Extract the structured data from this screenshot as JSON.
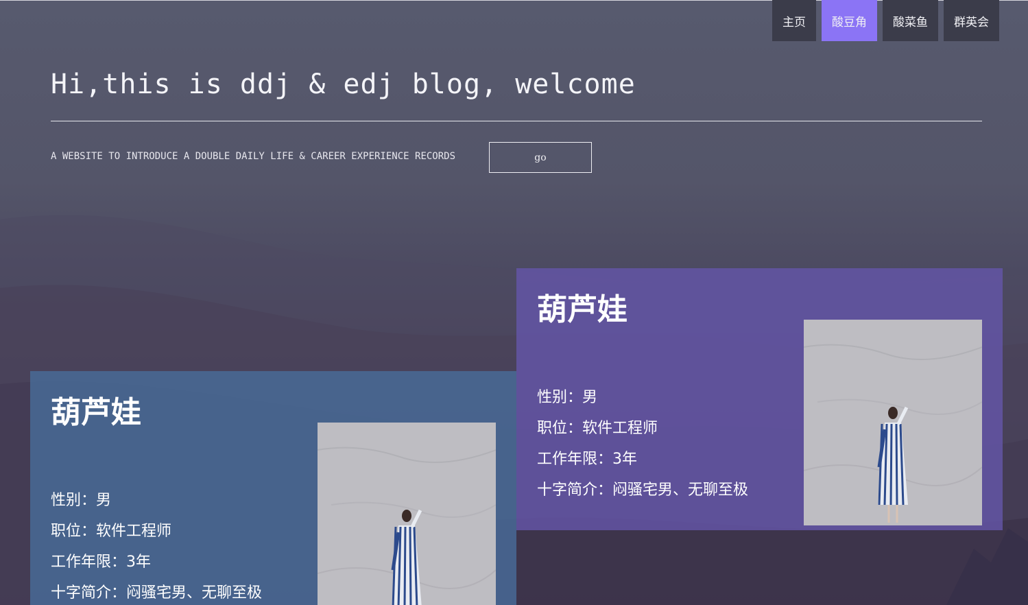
{
  "nav": {
    "items": [
      {
        "label": "主页",
        "active": false
      },
      {
        "label": "酸豆角",
        "active": true
      },
      {
        "label": "酸菜鱼",
        "active": false
      },
      {
        "label": "群英会",
        "active": false
      }
    ],
    "active_color": "#8b74f5"
  },
  "hero": {
    "title": "Hi,this is ddj & edj blog, welcome",
    "subtitle": "A WEBSITE TO INTRODUCE A DOUBLE DAILY LIFE & CAREER EXPERIENCE RECORDS",
    "go_label": "go"
  },
  "cards": [
    {
      "name": "葫芦娃",
      "gender": "性别：男",
      "position": "职位：软件工程师",
      "years": "工作年限：3年",
      "intro": "十字简介：闷骚宅男、无聊至极",
      "color": "#486a96"
    },
    {
      "name": "葫芦娃",
      "gender": "性别：男",
      "position": "职位：软件工程师",
      "years": "工作年限：3年",
      "intro": "十字简介：闷骚宅男、无聊至极",
      "color": "#6456a8"
    }
  ]
}
